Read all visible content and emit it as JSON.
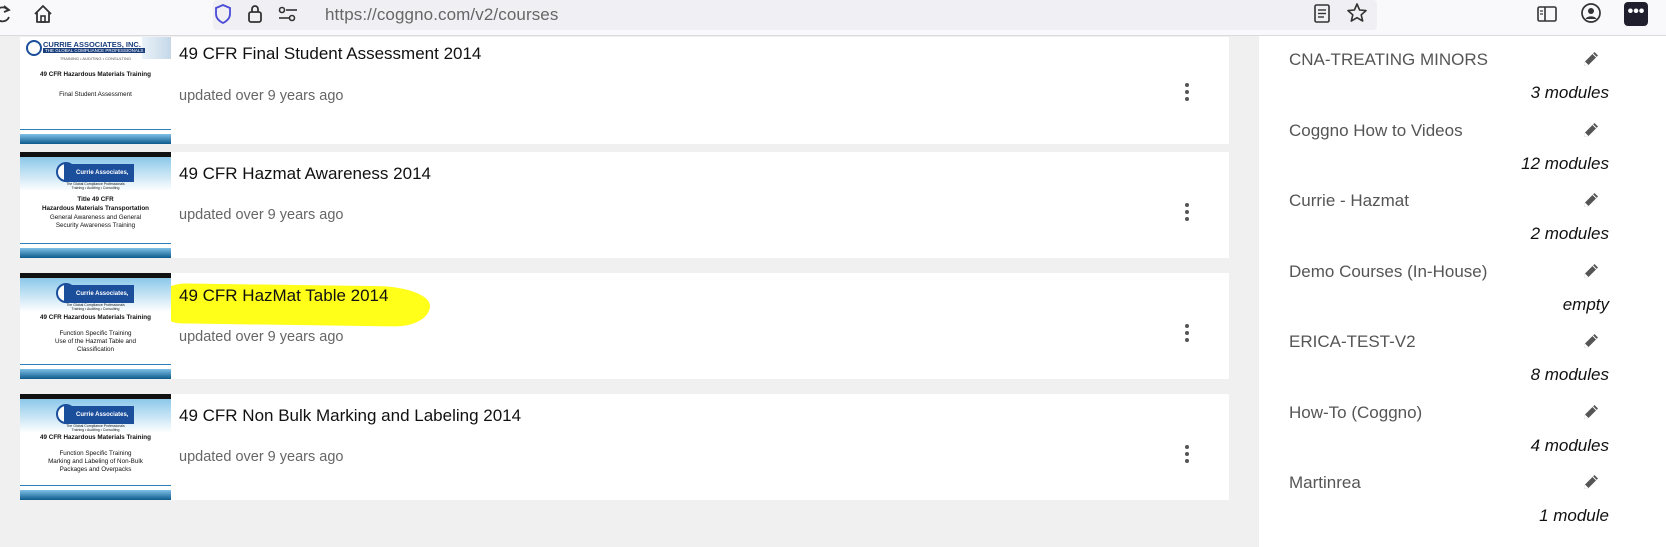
{
  "browser": {
    "url": "https://coggno.com/v2/courses",
    "extensions_label": "•••"
  },
  "courses": [
    {
      "title": "49 CFR Final Student Assessment 2014",
      "updated": "updated over 9 years ago",
      "thumb": {
        "logo": "CURRIE ASSOCIATES, INC.",
        "logo_sub": "THE GLOBAL COMPLIANCE PROFESSIONALS",
        "tagline": "TRAINING • AUDITING • CONSULTING",
        "lines": [
          {
            "text": "49 CFR Hazardous Materials Training",
            "bold": true
          },
          {
            "text": "Final Student Assessment",
            "bold": false
          }
        ]
      }
    },
    {
      "title": "49 CFR Hazmat Awareness 2014",
      "updated": "updated over 9 years ago",
      "thumb": {
        "logo": "Currie Associates, Inc.",
        "logo_sub": "The Global Compliance Professionals",
        "tagline": "Training • Auditing • Consulting",
        "lines": [
          {
            "text": "Title 49 CFR",
            "bold": true
          },
          {
            "text": "Hazardous Materials Transportation",
            "bold": true
          },
          {
            "text": "General Awareness and General",
            "bold": false
          },
          {
            "text": "Security Awareness Training",
            "bold": false
          }
        ]
      }
    },
    {
      "title": "49 CFR HazMat Table 2014",
      "updated": "updated over 9 years ago",
      "thumb": {
        "logo": "Currie Associates, Inc.",
        "logo_sub": "The Global Compliance Professionals",
        "tagline": "Training • Auditing • Consulting",
        "lines": [
          {
            "text": "49 CFR Hazardous Materials Training",
            "bold": true
          },
          {
            "text": "Function Specific Training",
            "bold": false
          },
          {
            "text": "Use of the Hazmat Table and",
            "bold": false
          },
          {
            "text": "Classification",
            "bold": false
          }
        ]
      }
    },
    {
      "title": "49 CFR Non Bulk Marking and Labeling 2014",
      "updated": "updated over 9 years ago",
      "thumb": {
        "logo": "Currie Associates, Inc.",
        "logo_sub": "The Global Compliance Professionals",
        "tagline": "Training • Auditing • Consulting",
        "lines": [
          {
            "text": "49 CFR Hazardous Materials Training",
            "bold": true
          },
          {
            "text": "Function Specific Training",
            "bold": false
          },
          {
            "text": "Marking and Labeling of Non-Bulk",
            "bold": false
          },
          {
            "text": "Packages and Overpacks",
            "bold": false
          }
        ]
      }
    }
  ],
  "sidebar": {
    "collections": [
      {
        "name": "CNA-TREATING MINORS",
        "count": "3 modules"
      },
      {
        "name": "Coggno How to Videos",
        "count": "12 modules"
      },
      {
        "name": "Currie - Hazmat",
        "count": "2 modules"
      },
      {
        "name": "Demo Courses (In-House)",
        "count": "empty"
      },
      {
        "name": "ERICA-TEST-V2",
        "count": "8 modules"
      },
      {
        "name": "How-To (Coggno)",
        "count": "4 modules"
      },
      {
        "name": "Martinrea",
        "count": "1 module"
      }
    ]
  },
  "colors": {
    "highlight": "#ffff1a",
    "thumbnail_band": "#0d5a8c",
    "logo_blue": "#1b4f9c"
  }
}
